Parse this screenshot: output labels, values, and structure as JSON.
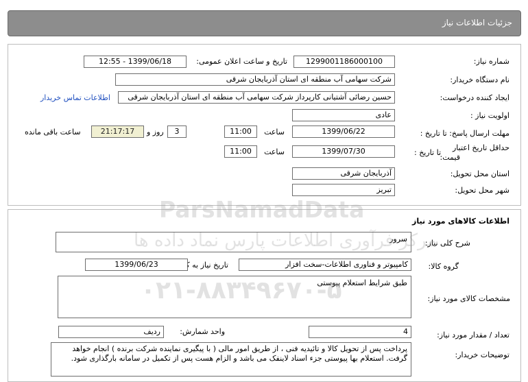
{
  "header": {
    "title": "جزئیات اطلاعات نیاز"
  },
  "top": {
    "need_number_label": "شماره نیاز:",
    "need_number": "1299001186000100",
    "announce_label": "تاریخ و ساعت اعلان عمومی:",
    "announce_value": "1399/06/18 - 12:55",
    "buyer_org_label": "نام دستگاه خریدار:",
    "buyer_org": "شرکت سهامی آب منطقه ای استان آذربایجان شرقی",
    "requester_label": "ایجاد کننده درخواست:",
    "requester": "حسین رضائی آشتیانی کارپرداز شرکت سهامی آب منطقه ای استان آذربایجان شرقی",
    "contact_link": "اطلاعات تماس خریدار",
    "priority_label": "اولویت نیاز :",
    "priority": "عادی",
    "deadline_label": "مهلت ارسال پاسخ: تا تاریخ :",
    "deadline_date": "1399/06/22",
    "time_label": "ساعت",
    "deadline_time": "11:00",
    "days_value": "3",
    "days_label": "روز و",
    "remaining_time": "21:17:17",
    "remaining_label": "ساعت باقی مانده",
    "validity_label_1": "حداقل تاریخ اعتبار",
    "validity_label_2": "قیمت:",
    "validity_until_label": "تا تاریخ :",
    "validity_date": "1399/07/30",
    "validity_time": "11:00",
    "province_label": "استان محل تحویل:",
    "province": "آذربایجان شرقی",
    "city_label": "شهر محل تحویل:",
    "city": "تبریز"
  },
  "goods": {
    "section_title": "اطلاعات کالاهای مورد نیاز",
    "desc_label": "شرح کلی نیاز:",
    "desc": "سرور",
    "group_label": "گروه کالا:",
    "group": "کامپیوتر و فناوری اطلاعات-سخت افزار",
    "need_date_label": "تاریخ نیاز به کالا:",
    "need_date": "1399/06/23",
    "specs_label": "مشخصات کالای مورد نیاز:",
    "specs": "طبق شرایط استعلام پیوستی",
    "qty_label": "تعداد / مقدار مورد نیاز:",
    "qty": "4",
    "unit_label": "واحد شمارش:",
    "unit": "ردیف",
    "notes_label": "توضیحات خریدار:",
    "notes": "پرداخت پس از تحویل کالا و تائیدیه فنی ، از طریق امور مالی ( با پیگیری نماینده شرکت برنده )  انجام خواهد گرفت. استعلام بها پیوستی جزء اسناد لاینفک می باشد و الزام هست پس از تکمیل در سامانه بارگذاری شود."
  },
  "watermark": {
    "brand": "ParsNamadData",
    "tagline": "مرکز فرآوری اطلاعات پارس نماد داده ها",
    "phone": "۰۲۱-۸۸۳۴۹۶۷۰-۵"
  }
}
